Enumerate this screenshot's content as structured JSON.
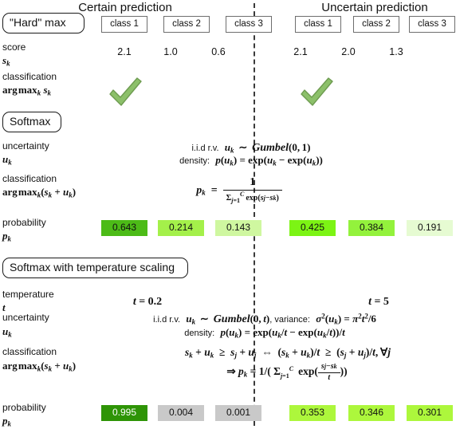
{
  "columns": {
    "group_headers": [
      {
        "label": "Certain prediction"
      },
      {
        "label": "Uncertain prediction"
      }
    ],
    "class_labels": [
      "class 1",
      "class 2",
      "class 3",
      "class 1",
      "class 2",
      "class 3"
    ]
  },
  "sections": [
    {
      "id": "hard-max",
      "title": "\"Hard\" max"
    },
    {
      "id": "softmax",
      "title": "Softmax"
    },
    {
      "id": "softmax-temp",
      "title": "Softmax with temperature scaling"
    }
  ],
  "rows": {
    "score": {
      "label_line1": "score",
      "label_line2_math": "s_k",
      "values": [
        "2.1",
        "1.0",
        "0.6",
        "2.1",
        "2.0",
        "1.3"
      ]
    },
    "classification_hard": {
      "label_line1": "classification",
      "label_line2_math": "arg max_k s_k",
      "marks": [
        "check",
        "check"
      ]
    },
    "uncertainty_softmax": {
      "label_line1": "uncertainty",
      "label_line2_math": "u_k",
      "formula_line1_prefix": "i.i.d r.v. ",
      "formula_line1": "u_k ~ Gumbel(0, 1)",
      "formula_line2_prefix": "density: ",
      "formula_line2": "p(u_k) = exp(u_k - exp(u_k))"
    },
    "classification_softmax": {
      "label_line1": "classification",
      "label_line2_math": "arg max_k(s_k + u_k)",
      "formula": "p_k = 1 / sum_{j=1}^{C} exp(s_j - s_k)"
    },
    "probability_softmax": {
      "label_line1": "probability",
      "label_line2_math": "p_k",
      "values": [
        "0.643",
        "0.214",
        "0.143",
        "0.425",
        "0.384",
        "0.191"
      ],
      "colors": [
        "#4cbb17",
        "#a4f04a",
        "#cff7a0",
        "#7cf414",
        "#93f23c",
        "#e6fbd2"
      ],
      "text_colors": [
        "#111111",
        "#111111",
        "#111111",
        "#111111",
        "#111111",
        "#111111"
      ]
    },
    "temperature": {
      "label_line1": "temperature",
      "label_line2_math": "t",
      "left_value": "t = 0.2",
      "right_value": "t = 5"
    },
    "uncertainty_temp": {
      "label_line1": "uncertainty",
      "label_line2_math": "u_k",
      "formula_line1_prefix": "i.i.d r.v. ",
      "formula_line1": "u_k ~ Gumbel(0, t), variance: sigma^2(u_k) = pi^2 t^2 / 6",
      "formula_line2_prefix": "density: ",
      "formula_line2": "p(u_k) = exp(u_k/t - exp(u_k/t))/t"
    },
    "classification_temp": {
      "label_line1": "classification",
      "label_line2_math": "arg max_k(s_k + u_k)",
      "formula_line1": "s_k + u_k >= s_j + u_j  <=>  (s_k + u_k)/t >= (s_j + u_j)/t, for all j",
      "formula_line2": "=> p_k = 1/( sum_{j=1}^{C} exp((s_j - s_k)/t) )"
    },
    "probability_temp": {
      "label_line1": "probability",
      "label_line2_math": "p_k",
      "values": [
        "0.995",
        "0.004",
        "0.001",
        "0.353",
        "0.346",
        "0.301"
      ],
      "colors": [
        "#2e9406",
        "#c9c9c9",
        "#c9c9c9",
        "#adf73c",
        "#adf73c",
        "#adf73c"
      ],
      "text_colors": [
        "#ffffff",
        "#111111",
        "#111111",
        "#111111",
        "#111111",
        "#111111"
      ]
    }
  },
  "colors": {
    "check_fill": "#8cc06a",
    "check_stroke": "#6d9b50",
    "divider": "#3a3a3a",
    "box_border": "#1a1a1a",
    "class_box_border": "#6e6e6e"
  }
}
